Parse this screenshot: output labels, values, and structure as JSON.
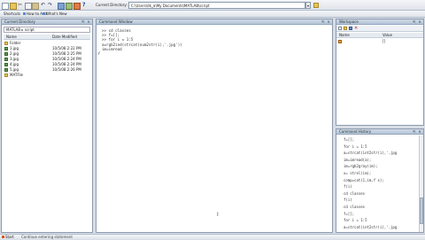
{
  "toolbar": {
    "shortcuts_label": "Shortcuts",
    "add_label": "How to Add",
    "whats_new_label": "What's New",
    "current_directory_label": "Current Directory:",
    "current_directory_value": "C:\\Users\\dk_a\\My Documents\\MATLAB\\script"
  },
  "current_directory": {
    "title": "Current Directory",
    "path_crumb": "MATLAB",
    "path_sub": "script",
    "columns": [
      "Name",
      "Date Modified"
    ],
    "items": [
      {
        "name": "Folder",
        "date": ""
      },
      {
        "name": "1.jpg",
        "date": "10/5/08 2:22 PM"
      },
      {
        "name": "2.jpg",
        "date": "10/5/08 2:25 PM"
      },
      {
        "name": "3.jpg",
        "date": "10/5/08 2:24 PM"
      },
      {
        "name": "4.jpg",
        "date": "10/5/08 2:24 PM"
      },
      {
        "name": "5.jpg",
        "date": "10/5/08 2:26 PM"
      },
      {
        "name": "MATFile",
        "date": ""
      }
    ]
  },
  "command_window": {
    "title": "Command Window",
    "lines": [
      ">> cd classes",
      ">> f=[];",
      ">> for i = 1:5",
      "a=rgb2ind(strcat(num2str(i),'.jpg'))",
      "im=imread"
    ]
  },
  "workspace": {
    "title": "Workspace",
    "columns": [
      "Name",
      "Value"
    ],
    "rows": [
      {
        "name": "",
        "value": "[]"
      }
    ]
  },
  "command_history": {
    "title": "Command History",
    "lines": [
      "f=[];",
      "for i = 1:5",
      "a=strcat(int2str(i),'.jpg",
      "im=imread(a);",
      "im=rgb2gray(im);",
      "x= strel(im);",
      "comp=cat(1,im,f x);",
      "f(i)",
      "cd classes",
      "f(i)",
      "cd classes",
      "f=[];",
      "for i = 1:5",
      "a=strcat(int2str(i),'.jpg"
    ]
  },
  "statusbar": {
    "start_label": "Start",
    "status_text": "Continue entering statement"
  },
  "colors": {
    "accent": "#b7c6d9",
    "panel_border": "#8c9bb0"
  }
}
